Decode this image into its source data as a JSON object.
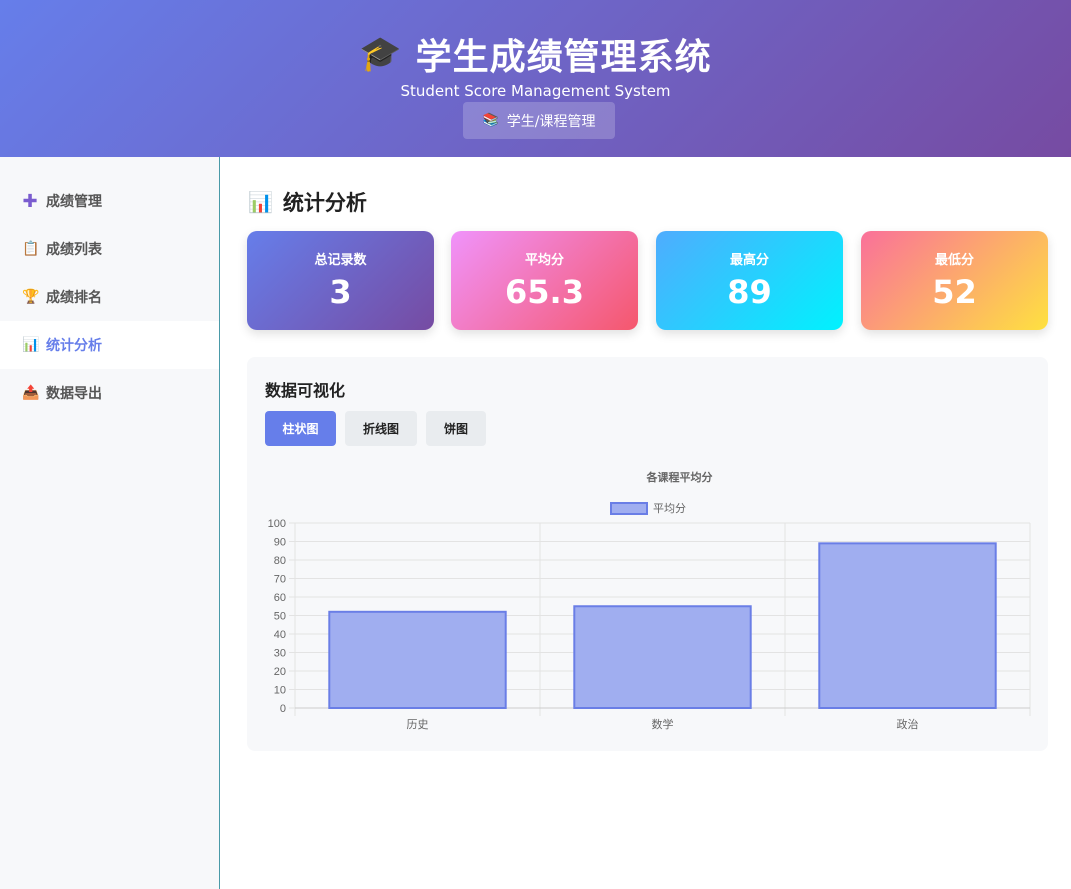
{
  "header": {
    "title": "学生成绩管理系统",
    "subtitle": "Student Score Management System",
    "mgmt_button": "学生/课程管理",
    "title_icon": "graduation-cap-icon",
    "mgmt_icon": "books-icon"
  },
  "sidebar": {
    "items": [
      {
        "label": "成绩管理",
        "icon": "plus-icon",
        "active": false
      },
      {
        "label": "成绩列表",
        "icon": "clipboard-icon",
        "active": false
      },
      {
        "label": "成绩排名",
        "icon": "trophy-icon",
        "active": false
      },
      {
        "label": "统计分析",
        "icon": "bar-chart-icon",
        "active": true
      },
      {
        "label": "数据导出",
        "icon": "outbox-icon",
        "active": false
      }
    ]
  },
  "main": {
    "section_title": "统计分析",
    "stats": [
      {
        "label": "总记录数",
        "value": "3"
      },
      {
        "label": "平均分",
        "value": "65.3"
      },
      {
        "label": "最高分",
        "value": "89"
      },
      {
        "label": "最低分",
        "value": "52"
      }
    ],
    "viz": {
      "title": "数据可视化",
      "tabs": [
        "柱状图",
        "折线图",
        "饼图"
      ],
      "active_tab": 0
    }
  },
  "colors": {
    "accent": "#667eea",
    "bar_fill": "#a0aef0",
    "bar_stroke": "#6a7ee6"
  },
  "chart_data": {
    "type": "bar",
    "title": "各课程平均分",
    "categories": [
      "历史",
      "数学",
      "政治"
    ],
    "series": [
      {
        "name": "平均分",
        "values": [
          52,
          55,
          89
        ]
      }
    ],
    "ylim": [
      0,
      100
    ],
    "yticks": [
      0,
      10,
      20,
      30,
      40,
      50,
      60,
      70,
      80,
      90,
      100
    ],
    "grid": true,
    "legend": "top-center"
  }
}
